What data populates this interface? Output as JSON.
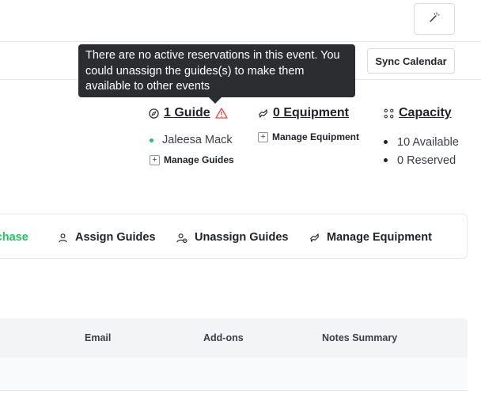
{
  "header": {
    "wand_icon": "magic-wand-icon",
    "sync_label": "Sync Calendar"
  },
  "tooltip": {
    "text": "There are no active reservations in this event. You could unassign the guides(s) to make them available to other events"
  },
  "guides": {
    "title": "1 Guide",
    "icon": "compass-icon",
    "warning_icon": "warning-triangle-icon",
    "items": [
      "Jaleesa Mack"
    ],
    "manage_label": "Manage Guides"
  },
  "equipment": {
    "title": "0 Equipment",
    "icon": "equipment-icon",
    "manage_label": "Manage Equipment"
  },
  "capacity": {
    "title": "Capacity",
    "icon": "capacity-icon",
    "items": [
      "10 Available",
      "0 Reserved"
    ]
  },
  "actions": {
    "purchase_label": "rchase",
    "assign_label": "Assign Guides",
    "unassign_label": "Unassign Guides",
    "equipment_label": "Manage Equipment"
  },
  "table": {
    "columns": [
      "Email",
      "Add-ons",
      "Notes Summary"
    ]
  },
  "colors": {
    "accent_green": "#22c55e",
    "warning_red": "#ef4444",
    "tooltip_bg": "#2b2d31"
  }
}
